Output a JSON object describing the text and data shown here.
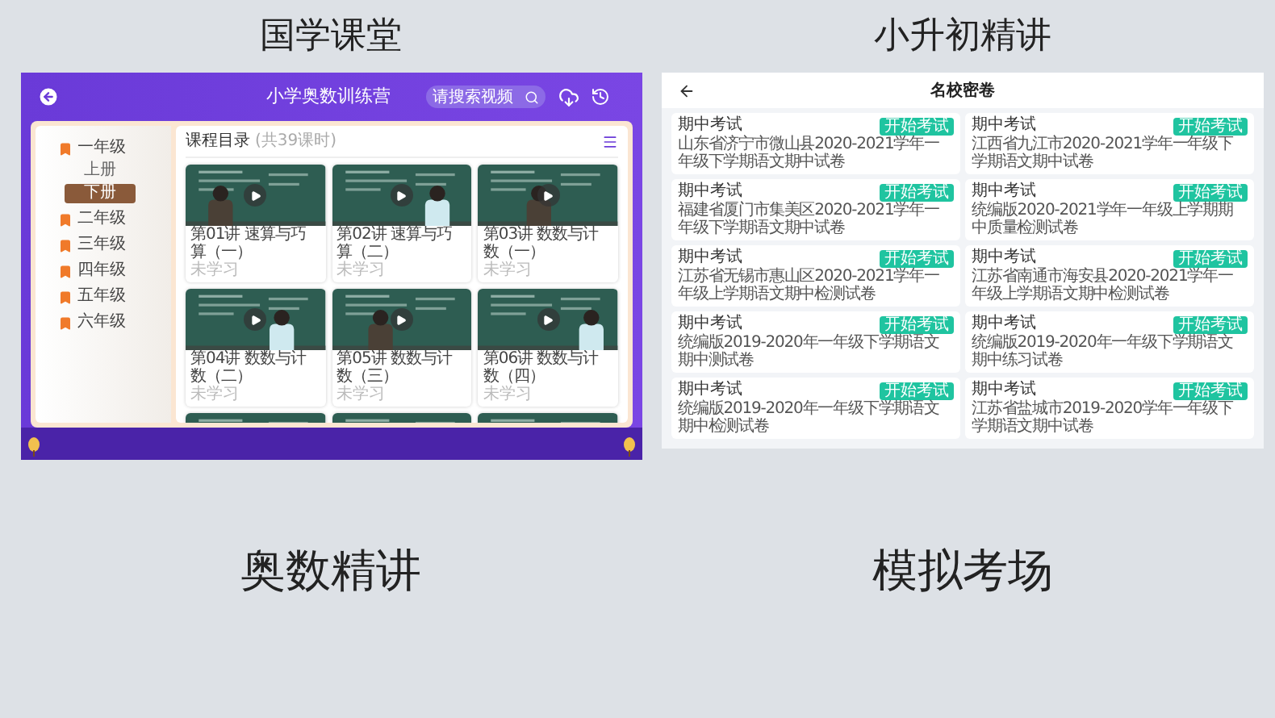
{
  "captions_top": [
    "国学课堂",
    "小升初精讲"
  ],
  "olympiad_app": {
    "title": "小学奥数训练营",
    "search_placeholder": "请搜索视频",
    "catalog_title": "课程目录",
    "catalog_count": "(共39课时)",
    "grades": [
      {
        "label": "一年级",
        "children": [
          {
            "label": "上册",
            "selected": false
          },
          {
            "label": "下册",
            "selected": true
          }
        ]
      },
      {
        "label": "二年级"
      },
      {
        "label": "三年级"
      },
      {
        "label": "四年级"
      },
      {
        "label": "五年级"
      },
      {
        "label": "六年级"
      }
    ],
    "lessons": [
      {
        "title": "第01讲 速算与巧算（一）",
        "status": "未学习"
      },
      {
        "title": "第02讲 速算与巧算（二）",
        "status": "未学习"
      },
      {
        "title": "第03讲 数数与计数（一）",
        "status": "未学习"
      },
      {
        "title": "第04讲 数数与计数（二）",
        "status": "未学习"
      },
      {
        "title": "第05讲 数数与计数（三）",
        "status": "未学习"
      },
      {
        "title": "第06讲 数数与计数（四）",
        "status": "未学习"
      }
    ]
  },
  "exam_app": {
    "title": "名校密卷",
    "papers": [
      {
        "title": "期中考试",
        "subtitle": "山东省济宁市微山县2020-2021学年一年级下学期语文期中试卷",
        "button": "开始考试"
      },
      {
        "title": "期中考试",
        "subtitle": "江西省九江市2020-2021学年一年级下学期语文期中试卷",
        "button": "开始考试"
      },
      {
        "title": "期中考试",
        "subtitle": "福建省厦门市集美区2020-2021学年一年级下学期语文期中试卷",
        "button": "开始考试"
      },
      {
        "title": "期中考试",
        "subtitle": "统编版2020-2021学年一年级上学期期中质量检测试卷",
        "button": "开始考试"
      },
      {
        "title": "期中考试",
        "subtitle": "江苏省无锡市惠山区2020-2021学年一年级上学期语文期中检测试卷",
        "button": "开始考试"
      },
      {
        "title": "期中考试",
        "subtitle": "江苏省南通市海安县2020-2021学年一年级上学期语文期中检测试卷",
        "button": "开始考试"
      },
      {
        "title": "期中考试",
        "subtitle": "统编版2019-2020年一年级下学期语文期中测试卷",
        "button": "开始考试"
      },
      {
        "title": "期中考试",
        "subtitle": "统编版2019-2020年一年级下学期语文期中练习试卷",
        "button": "开始考试"
      },
      {
        "title": "期中考试",
        "subtitle": "统编版2019-2020年一年级下学期语文期中检测试卷",
        "button": "开始考试"
      },
      {
        "title": "期中考试",
        "subtitle": "江苏省盐城市2019-2020学年一年级下学期语文期中试卷",
        "button": "开始考试"
      }
    ]
  },
  "captions_bottom": [
    "奥数精讲",
    "模拟考场"
  ]
}
